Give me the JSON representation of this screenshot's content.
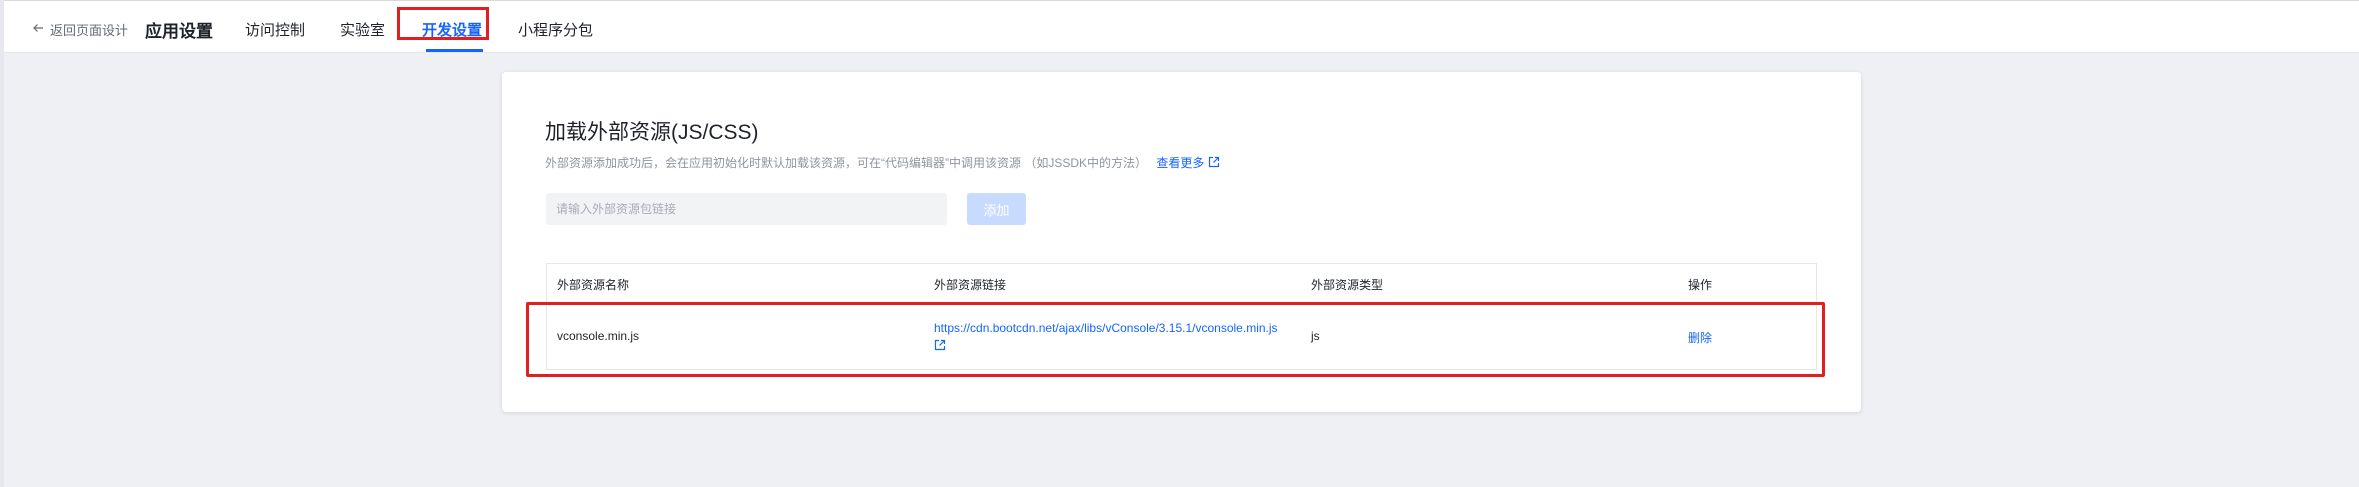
{
  "header": {
    "back_label": "返回页面设计",
    "page_title": "应用设置",
    "tabs": [
      {
        "label": "访问控制",
        "active": false
      },
      {
        "label": "实验室",
        "active": false
      },
      {
        "label": "开发设置",
        "active": true
      },
      {
        "label": "小程序分包",
        "active": false
      }
    ]
  },
  "card": {
    "title": "加载外部资源(JS/CSS)",
    "description": "外部资源添加成功后，会在应用初始化时默认加载该资源，可在“代码编辑器”中调用该资源 （如JSSDK中的方法）",
    "more_link": "查看更多",
    "input_placeholder": "请输入外部资源包链接",
    "add_button": "添加"
  },
  "table": {
    "columns": [
      "外部资源名称",
      "外部资源链接",
      "外部资源类型",
      "操作"
    ],
    "rows": [
      {
        "name": "vconsole.min.js",
        "url": "https://cdn.bootcdn.net/ajax/libs/vConsole/3.15.1/vconsole.min.js",
        "type": "js",
        "action": "删除"
      }
    ]
  },
  "icons": {
    "back": "arrow-left-icon",
    "external": "external-link-icon"
  },
  "colors": {
    "accent": "#1664ff",
    "highlight": "#e02020",
    "background": "#eef0f4",
    "disabled_button": "#c8dbff"
  }
}
